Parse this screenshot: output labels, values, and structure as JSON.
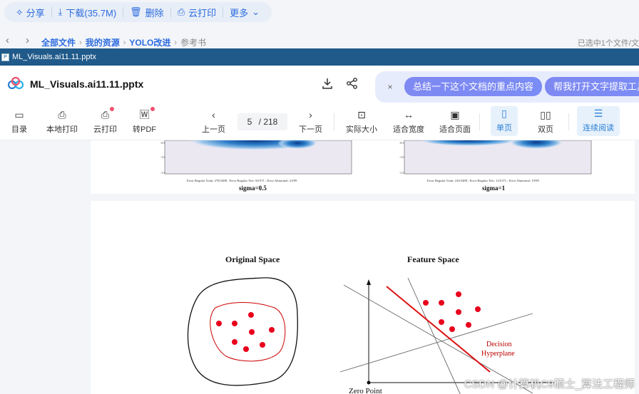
{
  "actions": [
    {
      "icon": "share-icon",
      "label": "分享"
    },
    {
      "icon": "download-icon",
      "label": "下载(35.7M)"
    },
    {
      "icon": "trash-icon",
      "label": "删除"
    },
    {
      "icon": "cloud-print-icon",
      "label": "云打印"
    },
    {
      "icon": "chevron-down-icon",
      "label": "更多"
    }
  ],
  "breadcrumb": {
    "items": [
      "全部文件",
      "我的资源",
      "YOLO改进",
      "参考书"
    ],
    "selection_text": "已选中1个文件/文"
  },
  "window": {
    "title": "ML_Visuals.ai11.11.pptx"
  },
  "doc": {
    "title": "ML_Visuals.ai11.11.pptx",
    "ai_chips": [
      "总结一下这个文档的重点内容",
      "帮我打开文字提取工具"
    ]
  },
  "toolbar": {
    "items": [
      {
        "icon": "outline-icon",
        "label": "目录"
      },
      {
        "icon": "printer-icon",
        "label": "本地打印"
      },
      {
        "icon": "cloud-print-icon",
        "label": "云打印"
      },
      {
        "icon": "word-icon",
        "label": "转PDF"
      },
      {
        "icon": "prev-page-icon",
        "label": "上一页"
      },
      {
        "icon": "next-page-icon",
        "label": "下一页"
      },
      {
        "icon": "actual-size-icon",
        "label": "实际大小"
      },
      {
        "icon": "fit-width-icon",
        "label": "适合宽度"
      },
      {
        "icon": "fit-page-icon",
        "label": "适合页面"
      },
      {
        "icon": "single-page-icon",
        "label": "单页"
      },
      {
        "icon": "double-page-icon",
        "label": "双页"
      },
      {
        "icon": "continuous-icon",
        "label": "连续阅读"
      }
    ],
    "page_current": "5",
    "page_total": "/ 218"
  },
  "slides": {
    "top": {
      "caption_left": "sigma=0.5",
      "caption_right": "sigma=1",
      "error_left": "Error Regular Train: 278/2488 ; Error Regular Test: 94/371 ; Error Abnormal: 23/99",
      "error_right": "Error Regular Train: 410/2488 ; Error Regular Test: 123/371 ; Error Abnormal: 19/99"
    },
    "main": {
      "title_left": "Original Space",
      "title_right": "Feature Space",
      "decision_label_1": "Decision",
      "decision_label_2": "Hyperplane",
      "zero_point": "Zero Point"
    }
  },
  "watermark": "CSDN @计算机C9硕士_算法工程师",
  "colors": {
    "accent_blue": "#2d6cdf",
    "title_bar": "#1f5a8a",
    "ai_chip": "#7f89f2",
    "point_red": "#e8001c"
  }
}
